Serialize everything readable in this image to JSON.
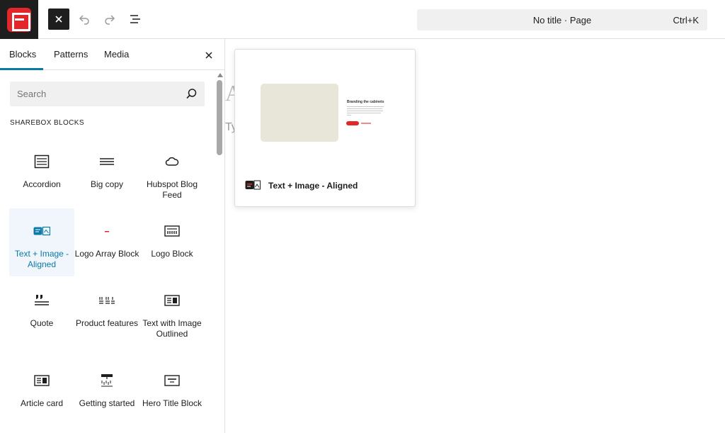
{
  "colors": {
    "accent": "#0a7aa7",
    "brand": "#e3262a",
    "dark": "#1e1e1e"
  },
  "header": {
    "undo_icon": "undo-icon",
    "redo_icon": "redo-icon",
    "outline_icon": "document-outline-icon",
    "command_title": "No title · Page",
    "command_shortcut": "Ctrl+K"
  },
  "inserter": {
    "tabs": [
      {
        "label": "Blocks",
        "active": true
      },
      {
        "label": "Patterns",
        "active": false
      },
      {
        "label": "Media",
        "active": false
      }
    ],
    "search_placeholder": "Search",
    "section_title": "SHAREBOX BLOCKS",
    "blocks": [
      {
        "label": "Accordion",
        "icon": "accordion-icon"
      },
      {
        "label": "Big copy",
        "icon": "big-copy-icon"
      },
      {
        "label": "Hubspot Blog Feed",
        "icon": "cloud-icon"
      },
      {
        "label": "Text + Image - Aligned",
        "icon": "text-image-icon",
        "selected": true
      },
      {
        "label": "Logo Array Block",
        "icon": "logo-array-icon"
      },
      {
        "label": "Logo Block",
        "icon": "logo-block-icon"
      },
      {
        "label": "Quote",
        "icon": "quote-icon"
      },
      {
        "label": "Product features",
        "icon": "product-features-icon"
      },
      {
        "label": "Text with Image Outlined",
        "icon": "text-image-outlined-icon"
      },
      {
        "label": "Article card",
        "icon": "article-card-icon"
      },
      {
        "label": "Getting started",
        "icon": "getting-started-icon"
      },
      {
        "label": "Hero Title Block",
        "icon": "hero-title-icon"
      }
    ]
  },
  "canvas": {
    "title_fragment": "A",
    "paragraph_fragment": "Ty"
  },
  "preview": {
    "heading": "Branding the cabinets",
    "block_name": "Text + Image - Aligned"
  }
}
